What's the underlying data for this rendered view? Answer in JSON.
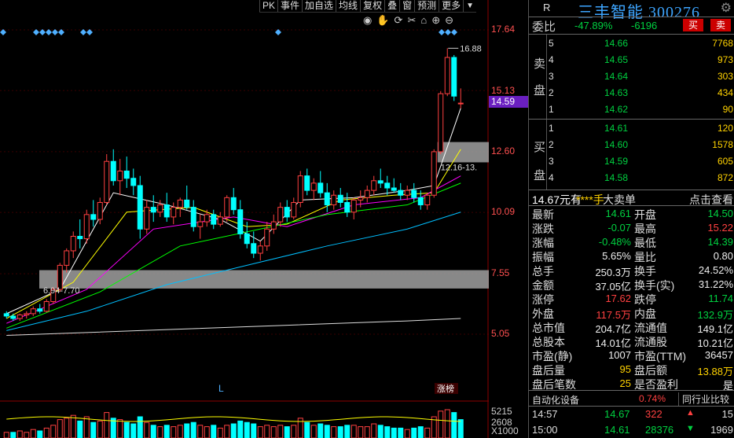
{
  "toolbar": {
    "items": [
      "PK",
      "事件",
      "加自选",
      "均线",
      "复权",
      "叠",
      "窗",
      "预测",
      "更多"
    ],
    "arrow": "▼"
  },
  "chart_tools": [
    "eye-icon",
    "hand-icon",
    "refresh-icon",
    "scissors-icon",
    "home-icon",
    "zoom-in-icon",
    "zoom-out-icon"
  ],
  "price_axis": [
    "17.64",
    "15.13",
    "12.60",
    "10.09",
    "7.55",
    "5.05"
  ],
  "current_price_tag": "14.59",
  "annotations": {
    "high": "16.88",
    "upper_range": "12.16-13.",
    "lower_range": "6.94-7.70",
    "l_marker": "L",
    "zt_marker": "涨榜"
  },
  "volume_axis": [
    "5215",
    "2608",
    "X1000"
  ],
  "panel": {
    "r_label": "R",
    "stock_name": "三丰智能 300276",
    "weibi_label": "委比",
    "weibi_value": "-47.89%",
    "weicha_value": "-6196",
    "buy_button": "买",
    "sell_button": "卖",
    "sell_side_label": [
      "卖",
      "盘"
    ],
    "buy_side_label": [
      "买",
      "盘"
    ],
    "asks": [
      {
        "level": "5",
        "price": "14.66",
        "qty": "7768"
      },
      {
        "level": "4",
        "price": "14.65",
        "qty": "973"
      },
      {
        "level": "3",
        "price": "14.64",
        "qty": "303"
      },
      {
        "level": "2",
        "price": "14.63",
        "qty": "434"
      },
      {
        "level": "1",
        "price": "14.62",
        "qty": "90"
      }
    ],
    "bids": [
      {
        "level": "1",
        "price": "14.61",
        "qty": "120"
      },
      {
        "level": "2",
        "price": "14.60",
        "qty": "1578"
      },
      {
        "level": "3",
        "price": "14.59",
        "qty": "605"
      },
      {
        "level": "4",
        "price": "14.58",
        "qty": "872"
      }
    ],
    "trade_head": {
      "price": "14.67元有",
      "hands": "****手",
      "dadan": "大卖单",
      "check": "点击查看"
    },
    "stats": [
      {
        "l1": "最新",
        "v1": "14.61",
        "c1": "c-green",
        "l2": "开盘",
        "v2": "14.50",
        "c2": "c-green"
      },
      {
        "l1": "涨跌",
        "v1": "-0.07",
        "c1": "c-green",
        "l2": "最高",
        "v2": "15.22",
        "c2": "c-red"
      },
      {
        "l1": "涨幅",
        "v1": "-0.48%",
        "c1": "c-green",
        "l2": "最低",
        "v2": "14.39",
        "c2": "c-green"
      },
      {
        "l1": "振幅",
        "v1": "5.65%",
        "c1": "c-white",
        "l2": "量比",
        "v2": "0.80",
        "c2": "c-white"
      },
      {
        "l1": "总手",
        "v1": "250.3万",
        "c1": "c-white",
        "l2": "换手",
        "v2": "24.52%",
        "c2": "c-white"
      },
      {
        "l1": "金额",
        "v1": "37.05亿",
        "c1": "c-white",
        "l2": "换手(实)",
        "v2": "31.22%",
        "c2": "c-white"
      },
      {
        "l1": "涨停",
        "v1": "17.62",
        "c1": "c-red",
        "l2": "跌停",
        "v2": "11.74",
        "c2": "c-green"
      },
      {
        "l1": "外盘",
        "v1": "117.5万",
        "c1": "c-red",
        "l2": "内盘",
        "v2": "132.9万",
        "c2": "c-green"
      },
      {
        "l1": "总市值",
        "v1": "204.7亿",
        "c1": "c-white",
        "l2": "流通值",
        "v2": "149.1亿",
        "c2": "c-white"
      },
      {
        "l1": "总股本",
        "v1": "14.01亿",
        "c1": "c-white",
        "l2": "流通股",
        "v2": "10.21亿",
        "c2": "c-white"
      },
      {
        "l1": "市盈(静)",
        "v1": "1007",
        "c1": "c-white",
        "l2": "市盈(TTM)",
        "v2": "36457",
        "c2": "c-white"
      },
      {
        "l1": "盘后量",
        "v1": "95",
        "c1": "c-yellow",
        "l2": "盘后额",
        "v2": "13.88万",
        "c2": "c-yellow"
      },
      {
        "l1": "盘后笔数",
        "v1": "25",
        "c1": "c-yellow",
        "l2": "是否盈利",
        "v2": "是",
        "c2": "c-white"
      }
    ],
    "sector": {
      "name": "自动化设备",
      "change": "0.74%",
      "compare": "同行业比较"
    },
    "ticks": [
      {
        "time": "14:57",
        "price": "14.67",
        "price_class": "c-green",
        "qty": "322",
        "qty_class": "c-red",
        "arrow": "▲",
        "arrow_class": "c-red",
        "num": "15"
      },
      {
        "time": "15:00",
        "price": "14.61",
        "price_class": "c-green",
        "qty": "28376",
        "qty_class": "c-green",
        "arrow": "▼",
        "arrow_class": "c-green",
        "num": "1969"
      }
    ]
  },
  "colors": {
    "up": "#ff4040",
    "down": "#00ffff",
    "ma5": "#ffffff",
    "ma10": "#ffff00",
    "ma20": "#ff00ff",
    "ma30": "#00ff00",
    "ma60": "#00bfff",
    "ma120": "#dddddd",
    "zone": "#a0a0a0"
  },
  "chart_data": {
    "type": "candlestick",
    "y_axis_range": [
      5.05,
      17.64
    ],
    "candles": [
      [
        5.9,
        6.0,
        5.7,
        5.8
      ],
      [
        5.8,
        5.9,
        5.6,
        5.7
      ],
      [
        5.7,
        5.9,
        5.6,
        5.85
      ],
      [
        5.85,
        6.0,
        5.7,
        5.9
      ],
      [
        5.9,
        6.2,
        5.8,
        6.1
      ],
      [
        6.1,
        6.3,
        5.9,
        6.0
      ],
      [
        6.0,
        6.5,
        5.95,
        6.4
      ],
      [
        6.4,
        7.0,
        6.3,
        6.9
      ],
      [
        6.9,
        8.0,
        6.8,
        7.9
      ],
      [
        7.9,
        8.6,
        7.6,
        8.5
      ],
      [
        8.5,
        9.3,
        8.2,
        9.1
      ],
      [
        9.1,
        9.8,
        8.6,
        9.0
      ],
      [
        9.0,
        10.2,
        8.8,
        10.0
      ],
      [
        10.0,
        10.6,
        9.5,
        9.8
      ],
      [
        9.8,
        10.7,
        9.6,
        10.5
      ],
      [
        10.5,
        12.5,
        10.4,
        12.2
      ],
      [
        12.2,
        12.7,
        11.2,
        11.4
      ],
      [
        11.4,
        12.3,
        10.8,
        11.8
      ],
      [
        11.8,
        12.4,
        11.1,
        11.5
      ],
      [
        11.5,
        11.9,
        10.8,
        11.2
      ],
      [
        11.2,
        11.6,
        9.0,
        9.4
      ],
      [
        9.4,
        10.6,
        9.2,
        10.3
      ],
      [
        10.3,
        10.8,
        9.7,
        10.1
      ],
      [
        10.1,
        10.6,
        9.9,
        10.4
      ],
      [
        10.4,
        10.9,
        9.7,
        9.9
      ],
      [
        9.9,
        10.5,
        9.6,
        10.3
      ],
      [
        10.3,
        10.7,
        9.9,
        10.6
      ],
      [
        10.6,
        11.2,
        10.2,
        10.3
      ],
      [
        10.3,
        10.6,
        9.3,
        9.5
      ],
      [
        9.5,
        10.0,
        9.0,
        9.7
      ],
      [
        9.7,
        10.2,
        9.5,
        10.0
      ],
      [
        10.0,
        10.2,
        9.4,
        9.6
      ],
      [
        9.6,
        10.1,
        9.5,
        9.9
      ],
      [
        9.9,
        10.8,
        9.7,
        10.7
      ],
      [
        10.7,
        11.1,
        10.0,
        10.2
      ],
      [
        10.2,
        10.6,
        9.0,
        9.2
      ],
      [
        9.2,
        9.7,
        8.6,
        8.8
      ],
      [
        8.8,
        9.3,
        8.2,
        8.4
      ],
      [
        8.4,
        8.9,
        8.1,
        8.7
      ],
      [
        8.7,
        9.7,
        8.5,
        9.4
      ],
      [
        9.4,
        10.0,
        9.2,
        9.7
      ],
      [
        9.7,
        10.5,
        9.5,
        10.3
      ],
      [
        10.3,
        10.6,
        9.7,
        9.9
      ],
      [
        9.9,
        10.7,
        9.8,
        10.5
      ],
      [
        10.5,
        11.8,
        10.3,
        11.6
      ],
      [
        11.6,
        11.9,
        10.8,
        11.0
      ],
      [
        11.0,
        11.5,
        10.6,
        11.3
      ],
      [
        11.3,
        11.8,
        10.7,
        10.9
      ],
      [
        10.9,
        11.3,
        10.1,
        10.4
      ],
      [
        10.4,
        11.0,
        10.2,
        10.8
      ],
      [
        10.8,
        11.1,
        10.3,
        10.5
      ],
      [
        10.5,
        10.9,
        9.9,
        10.1
      ],
      [
        10.1,
        10.7,
        9.8,
        10.6
      ],
      [
        10.6,
        11.0,
        10.3,
        10.7
      ],
      [
        10.7,
        11.2,
        10.5,
        11.0
      ],
      [
        11.0,
        11.6,
        10.8,
        11.4
      ],
      [
        11.4,
        11.9,
        11.1,
        11.3
      ],
      [
        11.3,
        11.6,
        10.8,
        11.1
      ],
      [
        11.1,
        11.5,
        10.9,
        11.0
      ],
      [
        11.0,
        11.3,
        10.6,
        10.8
      ],
      [
        10.8,
        11.2,
        10.6,
        11.0
      ],
      [
        11.0,
        11.3,
        10.5,
        10.7
      ],
      [
        10.7,
        11.0,
        10.2,
        10.4
      ],
      [
        10.4,
        10.9,
        10.2,
        10.8
      ],
      [
        10.8,
        12.7,
        10.7,
        12.6
      ],
      [
        12.6,
        15.1,
        12.5,
        15.0
      ],
      [
        15.0,
        16.88,
        14.9,
        16.5
      ],
      [
        16.5,
        16.6,
        14.7,
        14.9
      ],
      [
        14.6,
        15.22,
        14.39,
        14.61
      ]
    ],
    "volumes": [
      [
        0.2,
        0
      ],
      [
        0.2,
        1
      ],
      [
        0.25,
        0
      ],
      [
        0.2,
        0
      ],
      [
        0.3,
        0
      ],
      [
        0.25,
        1
      ],
      [
        0.35,
        0
      ],
      [
        0.45,
        0
      ],
      [
        0.65,
        0
      ],
      [
        0.7,
        0
      ],
      [
        0.8,
        0
      ],
      [
        0.6,
        1
      ],
      [
        0.75,
        0
      ],
      [
        0.55,
        1
      ],
      [
        0.6,
        0
      ],
      [
        0.9,
        0
      ],
      [
        0.7,
        1
      ],
      [
        0.65,
        0
      ],
      [
        0.55,
        1
      ],
      [
        0.5,
        1
      ],
      [
        0.75,
        1
      ],
      [
        0.55,
        0
      ],
      [
        0.45,
        1
      ],
      [
        0.4,
        0
      ],
      [
        0.45,
        1
      ],
      [
        0.4,
        0
      ],
      [
        0.45,
        0
      ],
      [
        0.5,
        1
      ],
      [
        0.55,
        1
      ],
      [
        0.45,
        0
      ],
      [
        0.4,
        0
      ],
      [
        0.45,
        1
      ],
      [
        0.35,
        0
      ],
      [
        0.45,
        0
      ],
      [
        0.5,
        1
      ],
      [
        0.6,
        1
      ],
      [
        0.55,
        1
      ],
      [
        0.5,
        1
      ],
      [
        0.4,
        0
      ],
      [
        0.45,
        0
      ],
      [
        0.4,
        0
      ],
      [
        0.45,
        0
      ],
      [
        0.4,
        1
      ],
      [
        0.45,
        0
      ],
      [
        0.7,
        0
      ],
      [
        0.55,
        1
      ],
      [
        0.45,
        0
      ],
      [
        0.5,
        1
      ],
      [
        0.45,
        1
      ],
      [
        0.4,
        0
      ],
      [
        0.4,
        1
      ],
      [
        0.45,
        1
      ],
      [
        0.45,
        0
      ],
      [
        0.4,
        0
      ],
      [
        0.4,
        0
      ],
      [
        0.5,
        0
      ],
      [
        0.45,
        1
      ],
      [
        0.4,
        1
      ],
      [
        0.35,
        1
      ],
      [
        0.35,
        1
      ],
      [
        0.3,
        0
      ],
      [
        0.35,
        1
      ],
      [
        0.4,
        1
      ],
      [
        0.35,
        0
      ],
      [
        0.75,
        0
      ],
      [
        0.95,
        0
      ],
      [
        1.0,
        0
      ],
      [
        0.9,
        1
      ],
      [
        0.65,
        1
      ]
    ],
    "ma_lines": {
      "ma5": [
        [
          0,
          5.9
        ],
        [
          8,
          6.9
        ],
        [
          16,
          10.9
        ],
        [
          24,
          10.4
        ],
        [
          32,
          9.8
        ],
        [
          38,
          8.9
        ],
        [
          44,
          10.6
        ],
        [
          52,
          10.7
        ],
        [
          60,
          11.0
        ],
        [
          64,
          11.2
        ],
        [
          68,
          14.4
        ]
      ],
      "ma10": [
        [
          0,
          5.7
        ],
        [
          10,
          7.2
        ],
        [
          18,
          10.1
        ],
        [
          28,
          10.3
        ],
        [
          36,
          9.5
        ],
        [
          42,
          9.6
        ],
        [
          50,
          10.6
        ],
        [
          58,
          10.8
        ],
        [
          64,
          10.9
        ],
        [
          68,
          12.7
        ]
      ],
      "ma20": [
        [
          0,
          5.5
        ],
        [
          12,
          6.9
        ],
        [
          22,
          9.4
        ],
        [
          34,
          9.9
        ],
        [
          42,
          9.5
        ],
        [
          52,
          10.4
        ],
        [
          62,
          10.7
        ],
        [
          68,
          11.6
        ]
      ],
      "ma30": [
        [
          0,
          5.3
        ],
        [
          14,
          6.8
        ],
        [
          26,
          8.7
        ],
        [
          38,
          9.4
        ],
        [
          48,
          10.0
        ],
        [
          60,
          10.4
        ],
        [
          68,
          11.3
        ]
      ],
      "ma60": [
        [
          0,
          5.2
        ],
        [
          12,
          6.0
        ],
        [
          24,
          7.1
        ],
        [
          36,
          7.9
        ],
        [
          48,
          8.7
        ],
        [
          60,
          9.4
        ],
        [
          68,
          10.1
        ]
      ],
      "ma120": [
        [
          0,
          5.0
        ],
        [
          20,
          5.2
        ],
        [
          40,
          5.4
        ],
        [
          60,
          5.6
        ],
        [
          68,
          5.7
        ]
      ]
    },
    "zones": [
      {
        "y_low": 6.94,
        "y_high": 7.7,
        "label": "6.94-7.70"
      },
      {
        "y_low": 12.16,
        "y_high": 13.0,
        "label": "12.16-13."
      }
    ]
  }
}
